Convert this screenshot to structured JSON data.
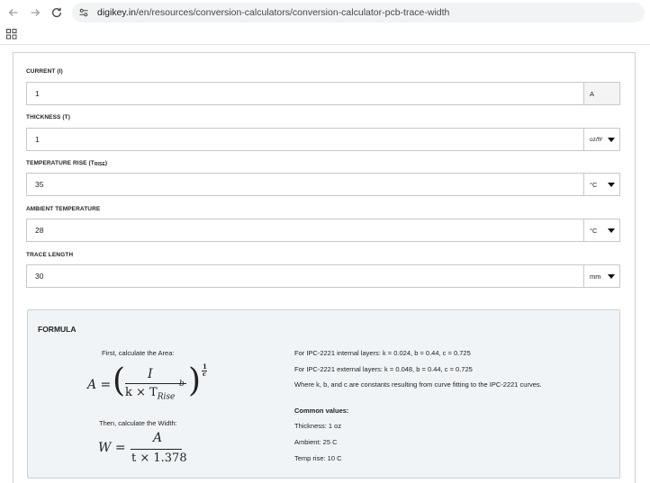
{
  "browser": {
    "url_domain": "digikey.in",
    "url_path": "/en/resources/conversion-calculators/conversion-calculator-pcb-trace-width"
  },
  "fields": [
    {
      "label": "CURRENT (I)",
      "value": "1",
      "unit": "A",
      "has_dropdown": false
    },
    {
      "label": "THICKNESS (T)",
      "value": "1",
      "unit": "oz/ft²",
      "has_dropdown": true
    },
    {
      "label_prefix": "TEMPERATURE RISE (T",
      "label_sub": "RISE",
      "label_suffix": ")",
      "value": "35",
      "unit": "°C",
      "has_dropdown": true
    },
    {
      "label": "AMBIENT TEMPERATURE",
      "value": "28",
      "unit": "°C",
      "has_dropdown": true
    },
    {
      "label": "TRACE LENGTH",
      "value": "30",
      "unit": "mm",
      "has_dropdown": true
    }
  ],
  "formula": {
    "title": "FORMULA",
    "step1": "First, calculate the Area:",
    "step2": "Then, calculate the Width:",
    "area_lhs": "A =",
    "area_num": "I",
    "area_den_k": "k × T",
    "area_den_sub": "Rise",
    "area_den_exp": "b",
    "area_exp_num": "1",
    "area_exp_den": "c",
    "width_lhs": "W =",
    "width_num": "A",
    "width_den": "t × 1.378",
    "notes": [
      "For IPC-2221 internal layers: k = 0.024, b = 0.44, c = 0.725",
      "For IPC-2221 external layers: k = 0.048, b = 0.44, c = 0.725",
      "Where k, b, and c are constants resulting from curve fitting to the IPC-2221 curves."
    ],
    "common_title": "Common values:",
    "common_values": [
      "Thickness: 1 oz",
      "Ambient: 25 C",
      "Temp rise: 10 C"
    ]
  }
}
